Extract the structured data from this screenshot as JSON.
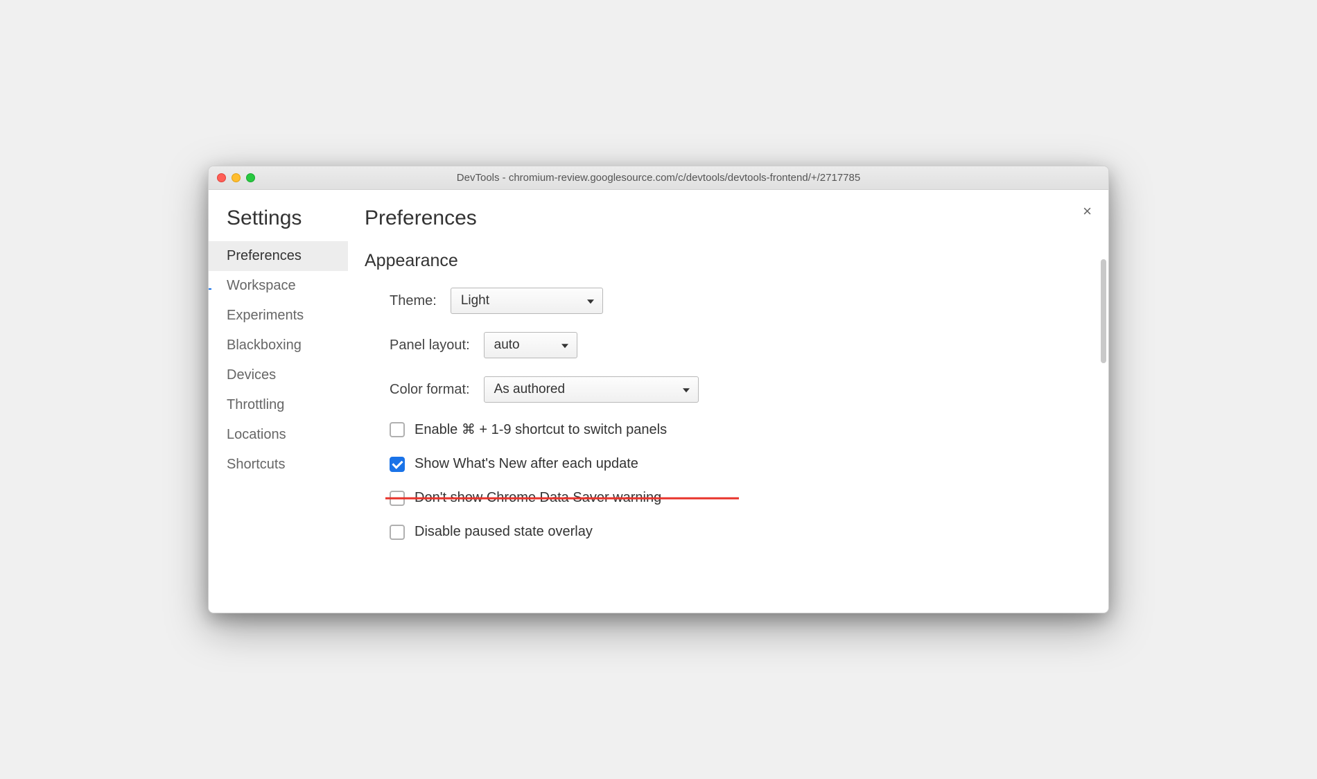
{
  "window": {
    "title": "DevTools - chromium-review.googlesource.com/c/devtools/devtools-frontend/+/2717785"
  },
  "sidebar": {
    "heading": "Settings",
    "items": [
      {
        "label": "Preferences",
        "active": true
      },
      {
        "label": "Workspace",
        "active": false
      },
      {
        "label": "Experiments",
        "active": false
      },
      {
        "label": "Blackboxing",
        "active": false
      },
      {
        "label": "Devices",
        "active": false
      },
      {
        "label": "Throttling",
        "active": false
      },
      {
        "label": "Locations",
        "active": false
      },
      {
        "label": "Shortcuts",
        "active": false
      }
    ]
  },
  "main": {
    "heading": "Preferences",
    "section": "Appearance",
    "fields": {
      "theme": {
        "label": "Theme:",
        "value": "Light"
      },
      "panel_layout": {
        "label": "Panel layout:",
        "value": "auto"
      },
      "color_format": {
        "label": "Color format:",
        "value": "As authored"
      }
    },
    "checkboxes": [
      {
        "label": "Enable ⌘ + 1-9 shortcut to switch panels",
        "checked": false,
        "struck": false
      },
      {
        "label": "Show What's New after each update",
        "checked": true,
        "struck": false
      },
      {
        "label": "Don't show Chrome Data Saver warning",
        "checked": false,
        "struck": true
      },
      {
        "label": "Disable paused state overlay",
        "checked": false,
        "struck": false
      }
    ]
  },
  "close_label": "×"
}
